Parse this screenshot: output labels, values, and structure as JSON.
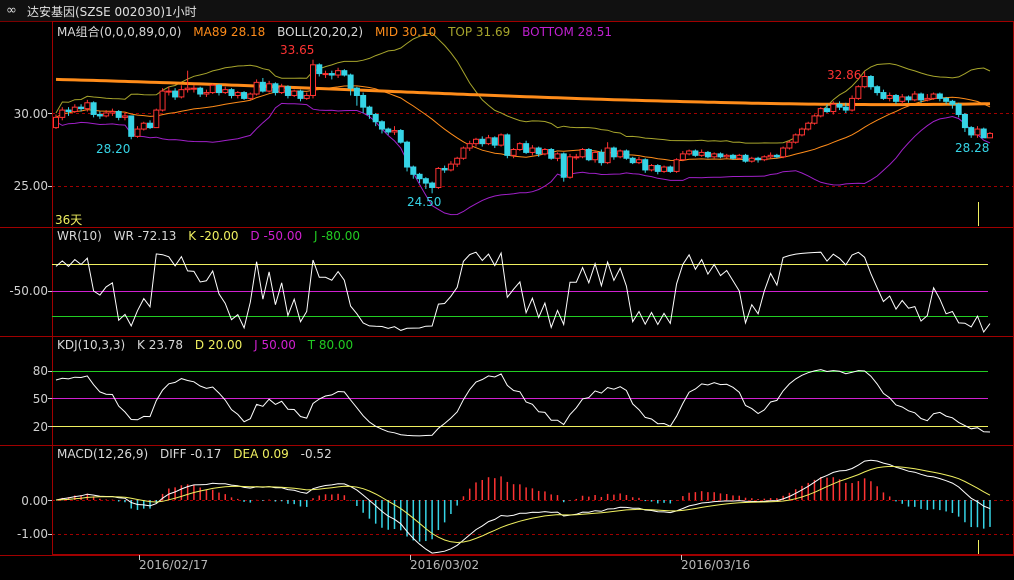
{
  "window": {
    "title": "达安基因(SZSE 002030)1小时",
    "icon": "infinity-link-icon"
  },
  "colors": {
    "up": "#ff3333",
    "down": "#36d4e6",
    "ma89": "#ff8c1a",
    "boll_mid": "#ff8c1a",
    "boll_top": "#a7a52c",
    "boll_bottom": "#a020c8",
    "white": "#ffffff",
    "yellow": "#f0f060",
    "magenta": "#d020d0",
    "green": "#22cc22",
    "grid": "#a00000"
  },
  "main_panel": {
    "legend": [
      {
        "text": "MA组合(0,0,0,89,0,0)",
        "color": "#d8d8d8"
      },
      {
        "text": "MA89 28.18",
        "color": "#ff8c1a"
      },
      {
        "text": "BOLL(20,20,2)",
        "color": "#d8d8d8"
      },
      {
        "text": "MID 30.10",
        "color": "#ff8c1a"
      },
      {
        "text": "TOP 31.69",
        "color": "#a7a52c"
      },
      {
        "text": "BOTTOM 28.51",
        "color": "#c020d0"
      }
    ],
    "y_ticks": [
      "30.00",
      "25.00"
    ],
    "y_tick_values": [
      30,
      25
    ],
    "period_label": "36天",
    "annotations": {
      "high1": "33.65",
      "high2": "32.86",
      "low1": "28.20",
      "low2": "24.50",
      "last": "28.28"
    }
  },
  "wr_panel": {
    "legend": [
      {
        "text": "WR(10)",
        "color": "#d8d8d8"
      },
      {
        "text": "WR -72.13",
        "color": "#d8d8d8"
      },
      {
        "text": "K -20.00",
        "color": "#f0f060"
      },
      {
        "text": "D -50.00",
        "color": "#d020d0"
      },
      {
        "text": "J -80.00",
        "color": "#22cc22"
      }
    ],
    "y_ticks": [
      "-50.00"
    ],
    "levels": [
      -20,
      -50,
      -80
    ]
  },
  "kdj_panel": {
    "legend": [
      {
        "text": "KDJ(10,3,3)",
        "color": "#d8d8d8"
      },
      {
        "text": "K 23.78",
        "color": "#d8d8d8"
      },
      {
        "text": "D 20.00",
        "color": "#f0f060"
      },
      {
        "text": "J 50.00",
        "color": "#d020d0"
      },
      {
        "text": "T 80.00",
        "color": "#22cc22"
      }
    ],
    "y_ticks": [
      "80",
      "50",
      "20"
    ],
    "levels": [
      80,
      50,
      20
    ]
  },
  "macd_panel": {
    "legend": [
      {
        "text": "MACD(12,26,9)",
        "color": "#d8d8d8"
      },
      {
        "text": "DIFF -0.17",
        "color": "#d8d8d8"
      },
      {
        "text": "DEA 0.09",
        "color": "#f0f060"
      },
      {
        "text": "-0.52",
        "color": "#d8d8d8"
      }
    ],
    "y_ticks": [
      "0.00",
      "-1.00"
    ],
    "y_tick_values": [
      0,
      -1
    ]
  },
  "x_axis": {
    "labels": [
      "2016/02/17",
      "2016/03/02",
      "2016/03/16"
    ]
  },
  "chart_data": {
    "type": "candlestick",
    "ylim": [
      22.5,
      35
    ],
    "candles": [
      [
        29.0,
        29.7,
        28.9,
        29.9
      ],
      [
        29.7,
        30.2,
        29.5,
        30.4
      ],
      [
        30.2,
        30.1,
        29.8,
        30.4
      ],
      [
        30.1,
        30.4,
        30.0,
        30.6
      ],
      [
        30.4,
        30.3,
        30.1,
        30.6
      ],
      [
        30.3,
        30.7,
        30.1,
        30.9
      ],
      [
        30.7,
        29.9,
        29.7,
        30.8
      ],
      [
        29.9,
        29.8,
        29.6,
        30.1
      ],
      [
        29.8,
        30.0,
        29.7,
        30.2
      ],
      [
        30.0,
        30.1,
        29.8,
        30.3
      ],
      [
        30.1,
        29.7,
        29.5,
        30.2
      ],
      [
        29.7,
        29.8,
        29.5,
        30.0
      ],
      [
        29.8,
        28.4,
        28.2,
        29.8
      ],
      [
        28.4,
        28.9,
        28.3,
        29.1
      ],
      [
        28.9,
        29.3,
        28.8,
        29.4
      ],
      [
        29.3,
        29.0,
        28.9,
        29.5
      ],
      [
        29.0,
        30.2,
        29.0,
        30.3
      ],
      [
        30.2,
        31.5,
        30.1,
        31.7
      ],
      [
        31.5,
        31.5,
        31.2,
        31.8
      ],
      [
        31.5,
        31.1,
        30.9,
        31.7
      ],
      [
        31.1,
        31.6,
        31.0,
        31.9
      ],
      [
        31.6,
        31.7,
        31.4,
        32.9
      ],
      [
        31.7,
        31.7,
        31.4,
        31.9
      ],
      [
        31.7,
        31.3,
        31.1,
        31.8
      ],
      [
        31.3,
        31.4,
        31.1,
        31.6
      ],
      [
        31.4,
        31.9,
        31.3,
        32.0
      ],
      [
        31.9,
        31.4,
        31.2,
        32.0
      ],
      [
        31.4,
        31.6,
        31.3,
        31.8
      ],
      [
        31.6,
        31.2,
        31.0,
        31.7
      ],
      [
        31.2,
        31.4,
        31.0,
        31.5
      ],
      [
        31.4,
        31.0,
        30.9,
        31.5
      ],
      [
        31.0,
        31.3,
        30.9,
        31.4
      ],
      [
        31.3,
        32.1,
        31.2,
        32.3
      ],
      [
        32.1,
        31.5,
        31.4,
        32.4
      ],
      [
        31.5,
        32.0,
        31.4,
        32.2
      ],
      [
        32.0,
        31.4,
        31.2,
        32.1
      ],
      [
        31.4,
        31.8,
        31.3,
        32.0
      ],
      [
        31.8,
        31.2,
        31.0,
        31.9
      ],
      [
        31.2,
        31.5,
        31.1,
        31.6
      ],
      [
        31.5,
        31.0,
        30.8,
        31.6
      ],
      [
        31.0,
        31.2,
        30.9,
        31.4
      ],
      [
        31.2,
        33.3,
        31.0,
        33.65
      ],
      [
        33.3,
        32.7,
        32.5,
        33.4
      ],
      [
        32.7,
        32.7,
        32.4,
        32.9
      ],
      [
        32.7,
        32.6,
        32.3,
        32.9
      ],
      [
        32.6,
        32.9,
        32.4,
        33.1
      ],
      [
        32.9,
        32.6,
        32.5,
        33.0
      ],
      [
        32.6,
        31.7,
        31.2,
        32.7
      ],
      [
        31.7,
        31.2,
        30.5,
        31.8
      ],
      [
        31.2,
        30.4,
        30.0,
        31.4
      ],
      [
        30.4,
        29.9,
        29.6,
        30.5
      ],
      [
        29.9,
        29.4,
        29.1,
        30.0
      ],
      [
        29.4,
        28.9,
        28.6,
        29.5
      ],
      [
        28.9,
        28.7,
        28.5,
        29.0
      ],
      [
        28.7,
        28.8,
        28.5,
        29.1
      ],
      [
        28.8,
        28.0,
        27.9,
        28.9
      ],
      [
        28.0,
        26.3,
        26.0,
        28.1
      ],
      [
        26.3,
        25.8,
        25.5,
        26.4
      ],
      [
        25.8,
        25.5,
        25.2,
        25.9
      ],
      [
        25.5,
        25.2,
        24.8,
        25.6
      ],
      [
        25.2,
        24.9,
        24.5,
        25.3
      ],
      [
        24.9,
        26.2,
        24.8,
        26.3
      ],
      [
        26.2,
        26.1,
        25.9,
        26.4
      ],
      [
        26.1,
        26.5,
        26.0,
        26.7
      ],
      [
        26.5,
        26.9,
        26.3,
        27.0
      ],
      [
        26.9,
        27.6,
        26.8,
        27.7
      ],
      [
        27.6,
        27.9,
        27.4,
        28.1
      ],
      [
        27.9,
        28.2,
        27.7,
        28.3
      ],
      [
        28.2,
        27.9,
        27.7,
        28.4
      ],
      [
        27.9,
        28.3,
        27.8,
        28.5
      ],
      [
        28.3,
        27.8,
        27.6,
        28.4
      ],
      [
        27.8,
        28.5,
        27.7,
        28.6
      ],
      [
        28.5,
        27.1,
        26.9,
        28.6
      ],
      [
        27.1,
        27.5,
        26.9,
        27.6
      ],
      [
        27.5,
        27.9,
        27.4,
        28.0
      ],
      [
        27.9,
        27.3,
        27.2,
        28.1
      ],
      [
        27.3,
        27.6,
        27.1,
        27.8
      ],
      [
        27.6,
        27.2,
        27.0,
        27.7
      ],
      [
        27.2,
        27.5,
        27.1,
        27.6
      ],
      [
        27.5,
        26.9,
        26.8,
        27.6
      ],
      [
        26.9,
        27.2,
        26.7,
        27.3
      ],
      [
        27.2,
        25.6,
        25.3,
        27.3
      ],
      [
        25.6,
        27.0,
        25.5,
        27.2
      ],
      [
        27.0,
        27.0,
        26.8,
        27.2
      ],
      [
        27.0,
        27.5,
        26.9,
        27.6
      ],
      [
        27.5,
        26.8,
        26.7,
        27.6
      ],
      [
        26.8,
        27.3,
        26.6,
        27.4
      ],
      [
        27.3,
        26.6,
        26.4,
        27.5
      ],
      [
        26.6,
        27.6,
        26.5,
        28.0
      ],
      [
        27.6,
        27.0,
        26.8,
        27.7
      ],
      [
        27.0,
        27.4,
        26.9,
        27.5
      ],
      [
        27.4,
        26.9,
        26.8,
        27.5
      ],
      [
        26.9,
        26.6,
        26.5,
        27.0
      ],
      [
        26.6,
        26.8,
        26.5,
        27.0
      ],
      [
        26.8,
        26.1,
        25.9,
        26.9
      ],
      [
        26.1,
        26.4,
        26.0,
        26.5
      ],
      [
        26.4,
        26.0,
        25.8,
        26.5
      ],
      [
        26.0,
        26.3,
        25.9,
        26.4
      ],
      [
        26.3,
        26.0,
        25.9,
        26.4
      ],
      [
        26.0,
        26.8,
        25.9,
        26.9
      ],
      [
        26.8,
        27.2,
        26.7,
        27.4
      ],
      [
        27.2,
        27.4,
        27.1,
        27.5
      ],
      [
        27.4,
        27.1,
        27.0,
        27.5
      ],
      [
        27.1,
        27.3,
        27.0,
        27.5
      ],
      [
        27.3,
        27.0,
        26.9,
        27.4
      ],
      [
        27.0,
        27.2,
        26.9,
        27.3
      ],
      [
        27.2,
        27.0,
        26.9,
        27.3
      ],
      [
        27.0,
        27.1,
        26.9,
        27.2
      ],
      [
        27.1,
        26.9,
        26.8,
        27.2
      ],
      [
        26.9,
        27.1,
        26.8,
        27.2
      ],
      [
        27.1,
        26.7,
        26.6,
        27.2
      ],
      [
        26.7,
        26.9,
        26.6,
        27.0
      ],
      [
        26.9,
        26.8,
        26.6,
        27.0
      ],
      [
        26.8,
        27.0,
        26.7,
        27.1
      ],
      [
        27.0,
        27.1,
        26.9,
        27.3
      ],
      [
        27.1,
        27.0,
        26.9,
        27.2
      ],
      [
        27.0,
        27.6,
        26.9,
        27.7
      ],
      [
        27.6,
        28.0,
        27.5,
        28.1
      ],
      [
        28.0,
        28.5,
        27.9,
        28.6
      ],
      [
        28.5,
        28.9,
        28.4,
        29.0
      ],
      [
        28.9,
        29.3,
        28.8,
        29.4
      ],
      [
        29.3,
        29.8,
        29.2,
        29.9
      ],
      [
        29.8,
        30.3,
        29.7,
        30.4
      ],
      [
        30.3,
        30.1,
        30.0,
        30.6
      ],
      [
        30.1,
        30.6,
        29.9,
        30.8
      ],
      [
        30.6,
        30.4,
        30.2,
        30.8
      ],
      [
        30.4,
        30.2,
        30.0,
        30.7
      ],
      [
        30.2,
        31.0,
        30.1,
        31.2
      ],
      [
        31.0,
        31.8,
        30.9,
        31.9
      ],
      [
        31.8,
        32.5,
        31.7,
        32.86
      ],
      [
        32.5,
        31.8,
        31.6,
        32.6
      ],
      [
        31.8,
        31.4,
        31.2,
        31.9
      ],
      [
        31.4,
        31.0,
        30.9,
        31.6
      ],
      [
        31.0,
        31.2,
        30.8,
        31.4
      ],
      [
        31.2,
        30.8,
        30.6,
        31.3
      ],
      [
        30.8,
        31.1,
        30.6,
        31.3
      ],
      [
        31.1,
        30.9,
        30.7,
        31.2
      ],
      [
        30.9,
        31.3,
        30.8,
        31.5
      ],
      [
        31.3,
        30.9,
        30.7,
        31.4
      ],
      [
        30.9,
        31.0,
        30.8,
        31.3
      ],
      [
        31.0,
        31.3,
        30.9,
        31.4
      ],
      [
        31.3,
        31.0,
        30.8,
        31.4
      ],
      [
        31.0,
        30.8,
        30.6,
        31.1
      ],
      [
        30.8,
        30.6,
        30.3,
        30.9
      ],
      [
        30.6,
        29.9,
        29.7,
        30.7
      ],
      [
        29.9,
        29.0,
        28.7,
        30.0
      ],
      [
        29.0,
        28.5,
        28.3,
        29.1
      ],
      [
        28.5,
        28.9,
        28.3,
        29.1
      ],
      [
        28.9,
        28.3,
        28.3,
        29.0
      ],
      [
        28.3,
        28.6,
        28.28,
        28.7
      ]
    ]
  }
}
